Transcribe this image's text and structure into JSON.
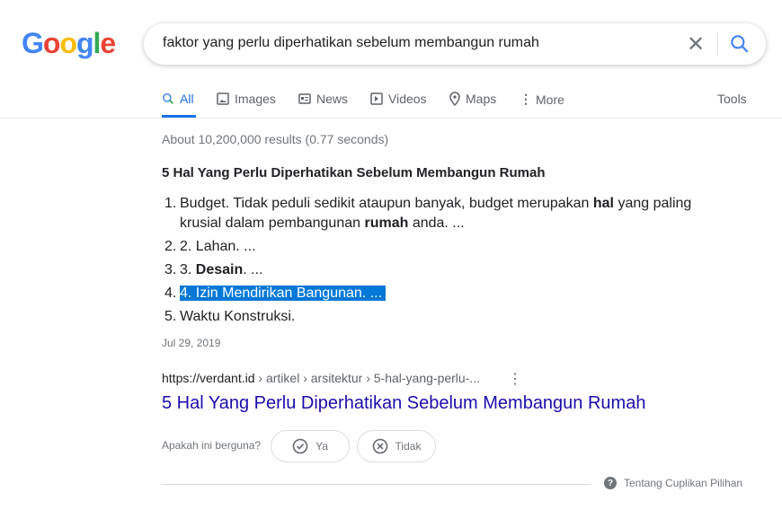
{
  "logo": {
    "text": "Google",
    "letters": [
      "G",
      "o",
      "o",
      "g",
      "l",
      "e"
    ],
    "colors": [
      "#4285f4",
      "#ea4335",
      "#fbbc05",
      "#4285f4",
      "#34a853",
      "#ea4335"
    ]
  },
  "search": {
    "query": "faktor yang perlu diperhatikan sebelum membangun rumah",
    "clear_icon": "close-icon",
    "search_icon": "search-icon"
  },
  "tabs": [
    {
      "label": "All",
      "icon": "search-icon",
      "active": true
    },
    {
      "label": "Images",
      "icon": "image-icon"
    },
    {
      "label": "News",
      "icon": "news-icon"
    },
    {
      "label": "Videos",
      "icon": "video-icon"
    },
    {
      "label": "Maps",
      "icon": "map-pin-icon"
    },
    {
      "label": "More",
      "icon": "more-vert-icon"
    }
  ],
  "tools_label": "Tools",
  "stats": "About 10,200,000 results (0.77 seconds)",
  "snippet": {
    "heading": "5 Hal Yang Perlu Diperhatikan Sebelum Membangun Rumah",
    "items": [
      {
        "num": "1.",
        "parts": [
          "Budget. Tidak peduli sedikit ataupun banyak, budget merupakan ",
          "hal",
          " yang paling krusial dalam pembangunan ",
          "rumah",
          " anda. ..."
        ]
      },
      {
        "num": "2.",
        "text": "2. Lahan. ..."
      },
      {
        "num": "3.",
        "pre": "3. ",
        "bold": "Desain",
        "post": ". ..."
      },
      {
        "num": "4.",
        "text": "4. Izin Mendirikan Bangunan. ...",
        "selected": true
      },
      {
        "num": "5.",
        "text": "Waktu Konstruksi."
      }
    ],
    "date": "Jul 29, 2019"
  },
  "result": {
    "url_base": "https://verdant.id",
    "url_path": " › artikel › arsitektur › 5-hal-yang-perlu-...",
    "title": "5 Hal Yang Perlu Diperhatikan Sebelum Membangun Rumah",
    "link_color": "#1a0dab"
  },
  "feedback": {
    "question": "Apakah ini berguna?",
    "yes": "Ya",
    "no": "Tidak"
  },
  "about_snippets": "Tentang Cuplikan Pilihan",
  "colors": {
    "accent": "#1a73e8",
    "selection": "#0078d7"
  }
}
